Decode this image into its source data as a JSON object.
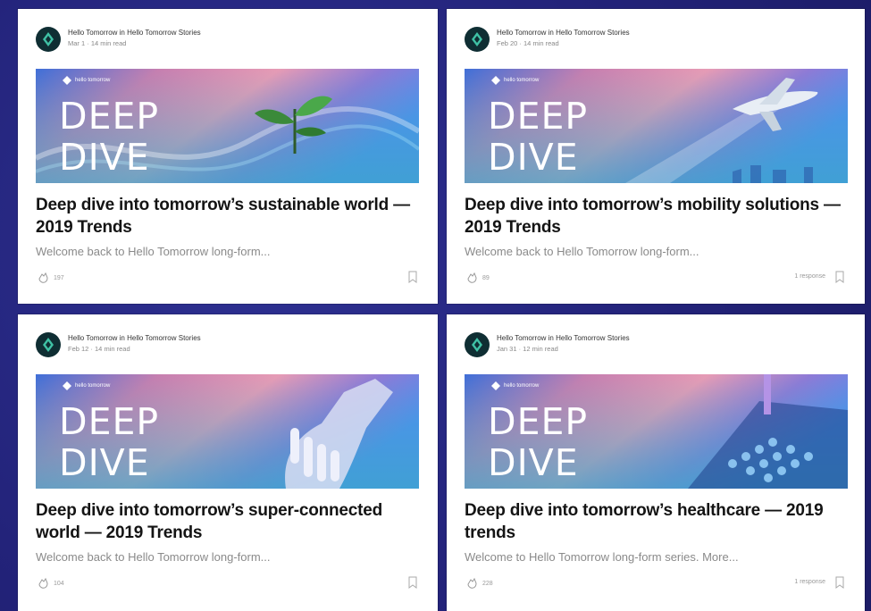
{
  "cards": [
    {
      "author": "Hello Tomorrow in Hello Tomorrow Stories",
      "date": "Mar 1 · 14 min read",
      "brand_label": "hello tomorrow",
      "banner_line1": "DEEP",
      "banner_line2": "DIVE",
      "banner_icon": "plant-sprout",
      "title": "Deep dive into tomorrow’s sustainable world — 2019 Trends",
      "excerpt": "Welcome back to Hello Tomorrow long-form...",
      "claps": "197",
      "responses": ""
    },
    {
      "author": "Hello Tomorrow in Hello Tomorrow Stories",
      "date": "Feb 20 · 14 min read",
      "brand_label": "hello tomorrow",
      "banner_line1": "DEEP",
      "banner_line2": "DIVE",
      "banner_icon": "airplane",
      "title": "Deep dive into tomorrow’s mobility solutions — 2019 Trends",
      "excerpt": "Welcome back to Hello Tomorrow long-form...",
      "claps": "89",
      "responses": "1 response"
    },
    {
      "author": "Hello Tomorrow in Hello Tomorrow Stories",
      "date": "Feb 12 · 14 min read",
      "brand_label": "hello tomorrow",
      "banner_line1": "DEEP",
      "banner_line2": "DIVE",
      "banner_icon": "robot-hand",
      "title": "Deep dive into tomorrow’s super-connected world — 2019 Trends",
      "excerpt": "Welcome back to Hello Tomorrow long-form...",
      "claps": "104",
      "responses": ""
    },
    {
      "author": "Hello Tomorrow in Hello Tomorrow Stories",
      "date": "Jan 31 · 12 min read",
      "brand_label": "hello tomorrow",
      "banner_line1": "DEEP",
      "banner_line2": "DIVE",
      "banner_icon": "lab-tubes",
      "title": "Deep dive into tomorrow’s healthcare — 2019 trends",
      "excerpt": "Welcome to Hello Tomorrow long-form series. More...",
      "claps": "228",
      "responses": "1 response"
    }
  ],
  "colors": {
    "background": "#23237a",
    "card": "#ffffff",
    "title_text": "#141414",
    "muted_text": "#8a8a8a",
    "banner_pink": "#e98fb0",
    "banner_blue": "#3f7fe0",
    "banner_purple": "#8a6fd0"
  }
}
